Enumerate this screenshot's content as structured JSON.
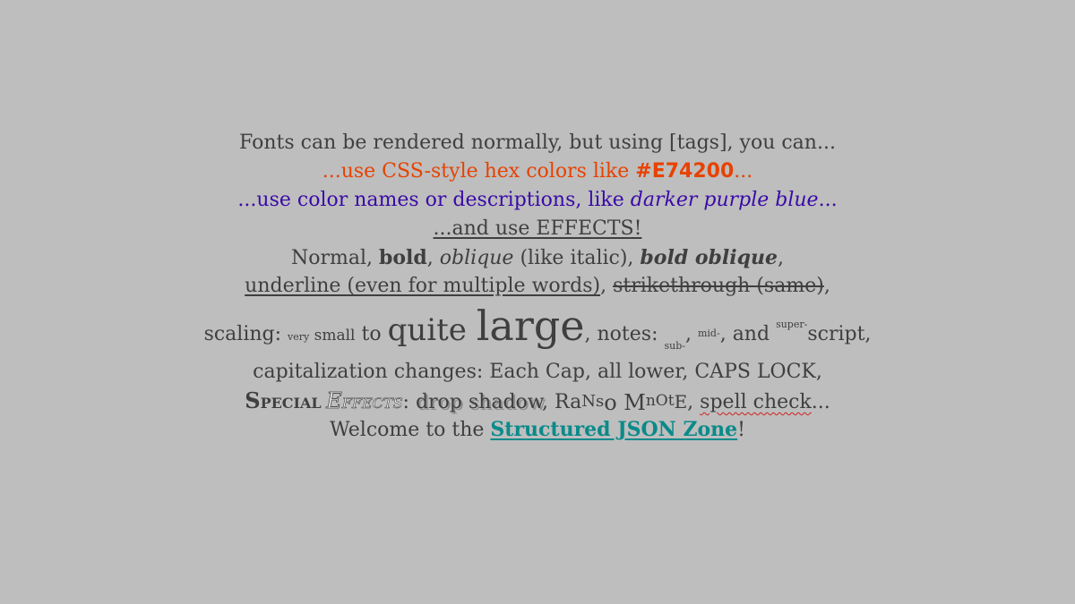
{
  "lines": {
    "l1": "Fonts can be rendered normally, but using [tags], you can...",
    "l2_pre": "...use CSS-style hex colors like ",
    "l2_hex": "#E74200",
    "l2_post": "...",
    "l3_pre": "...use color names or descriptions, like ",
    "l3_em": "darker purple blue",
    "l3_post": "...",
    "l4": "...and use EFFECTS!",
    "l5": {
      "normal": "Normal, ",
      "bold": "bold",
      "sep1": ", ",
      "oblique": "oblique",
      "paren": " (like italic), ",
      "boldobl": "bold oblique",
      "end": ","
    },
    "l6": {
      "underline": "underline (even for multiple words)",
      "sep": ", ",
      "strike": "strikethrough (same)",
      "end": ","
    },
    "l7": {
      "scaling": "scaling: ",
      "very": "very",
      "small": " small",
      "to": " to ",
      "quite": "quite ",
      "large": "large",
      "notes": ", notes: ",
      "sub": "sub-",
      "comma1": ", ",
      "mid": "mid-",
      "and": ", and ",
      "super": "super-",
      "script": "script,"
    },
    "l8": "capitalization changes: Each Cap, all lower, CAPS LOCK,",
    "l9": {
      "special_S": "S",
      "special_rest": "pecial ",
      "effects_E": "E",
      "effects_rest": "ffects",
      "colon": ": ",
      "drop_shadow": "drop shadow",
      "sep": ", ",
      "ransom": [
        "Ra",
        "Ns",
        "o M",
        "nOt",
        "E"
      ],
      "sep2": ", ",
      "spell": "spell check",
      "end": "..."
    },
    "l10": {
      "pre": "Welcome to the ",
      "zone": "Structured JSON Zone",
      "end": "!"
    }
  },
  "colors": {
    "background": "#bebebe",
    "text": "#3f3f3f",
    "hex_orange": "#e74200",
    "purple_blue": "#3a0aa8",
    "teal_link": "#0a8a8a"
  }
}
